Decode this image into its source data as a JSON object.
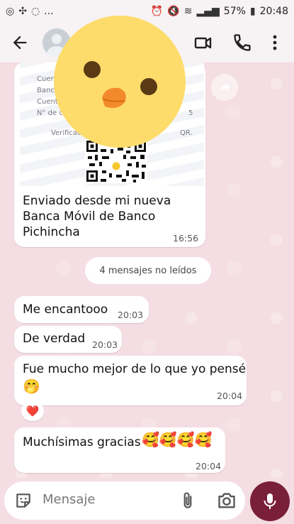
{
  "status_bar": {
    "battery_percent": "57%",
    "time": "20:48",
    "left_extra": "..."
  },
  "receipt": {
    "lines": [
      "Cuen",
      "Banc",
      "Cuent",
      "N° de c"
    ],
    "right_fragment": "5",
    "verification": "Verificac",
    "verification_end": "QR.",
    "caption": "Enviado desde mi nueva Banca Móvil de Banco Pichincha",
    "time": "16:56"
  },
  "unread_label": "4 mensajes no leídos",
  "messages": [
    {
      "text": "Me encantooo",
      "time": "20:03"
    },
    {
      "text": "De verdad",
      "time": "20:03"
    },
    {
      "text": "Fue mucho mejor de lo que yo pensé",
      "emoji": "🤭",
      "time": "20:04",
      "reaction": "❤️"
    },
    {
      "text": "Muchísimas gracias",
      "emoji": "🥰🥰🥰🥰",
      "time": "20:04"
    }
  ],
  "composer": {
    "placeholder": "Mensaje"
  },
  "colors": {
    "accent": "#7a1f3b",
    "background": "#f4dde3",
    "bubble": "#ffffff"
  },
  "icons": {
    "back": "back-arrow-icon",
    "video": "video-call-icon",
    "call": "phone-icon",
    "menu": "more-vert-icon",
    "emoji": "sticker-icon",
    "attach": "paperclip-icon",
    "camera": "camera-icon",
    "mic": "microphone-icon",
    "forward": "forward-icon"
  }
}
